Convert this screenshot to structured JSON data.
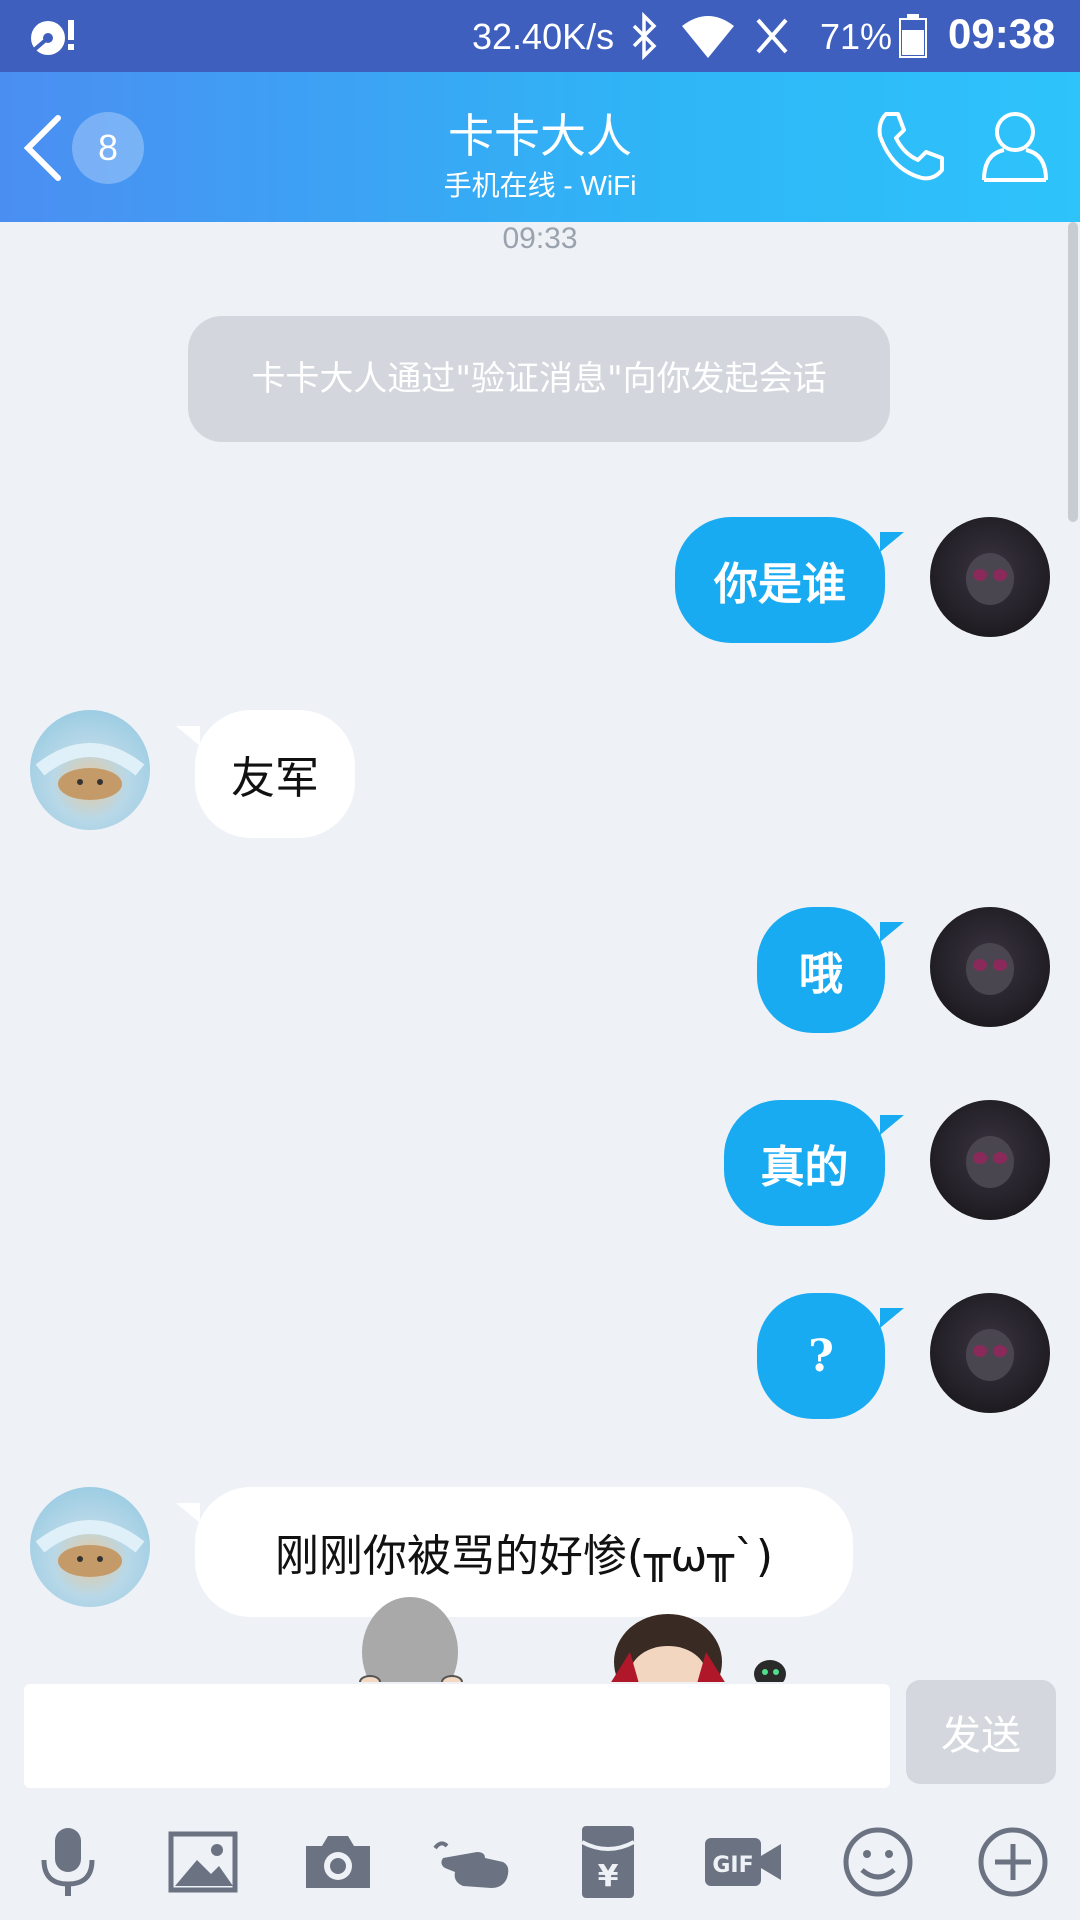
{
  "status_bar": {
    "speed": "32.40K/s",
    "battery": "71%",
    "time": "09:38"
  },
  "header": {
    "unread_count": "8",
    "title": "卡卡大人",
    "subtitle": "手机在线 - WiFi"
  },
  "chat": {
    "timestamp": "09:33",
    "system_message": "卡卡大人通过\"验证消息\"向你发起会话",
    "messages": [
      {
        "sender": "me",
        "text": "你是谁"
      },
      {
        "sender": "other",
        "text": "友军"
      },
      {
        "sender": "me",
        "text": "哦"
      },
      {
        "sender": "me",
        "text": "真的"
      },
      {
        "sender": "me",
        "text": "?"
      },
      {
        "sender": "other",
        "text": "刚刚你被骂的好惨(╥ω╥`)"
      }
    ]
  },
  "input": {
    "value": "",
    "send_label": "发送"
  },
  "toolbar_icons": [
    "microphone-icon",
    "image-icon",
    "camera-icon",
    "poke-icon",
    "red-packet-icon",
    "gif-icon",
    "emoji-icon",
    "plus-icon"
  ],
  "colors": {
    "status_bar": "#3f5fbf",
    "header_start": "#4b8ef2",
    "header_end": "#2ec3fb",
    "my_bubble": "#19abf2",
    "other_bubble": "#ffffff",
    "background": "#eef1f6"
  }
}
